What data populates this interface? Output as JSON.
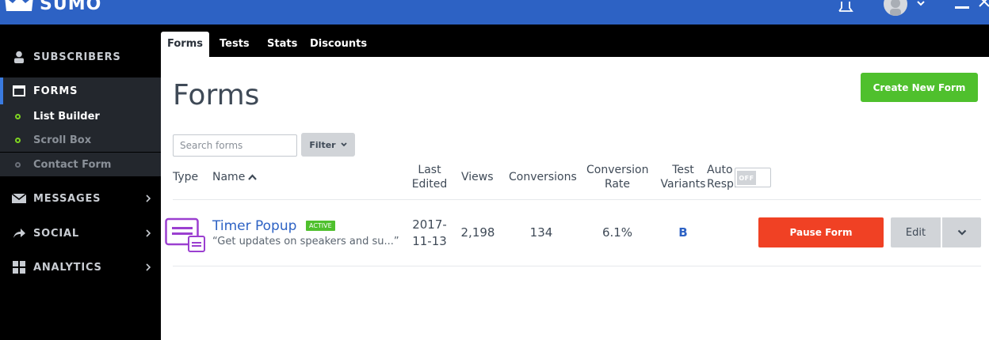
{
  "app": {
    "logo_text": "SUMO"
  },
  "sidebar": {
    "items": [
      {
        "label": "SUBSCRIBERS"
      },
      {
        "label": "FORMS"
      },
      {
        "label": "MESSAGES"
      },
      {
        "label": "SOCIAL"
      },
      {
        "label": "ANALYTICS"
      }
    ],
    "sub_items": [
      {
        "label": "List Builder"
      },
      {
        "label": "Scroll Box"
      },
      {
        "label": "Contact Form"
      }
    ]
  },
  "tabs": [
    {
      "label": "Forms"
    },
    {
      "label": "Tests"
    },
    {
      "label": "Stats"
    },
    {
      "label": "Discounts"
    }
  ],
  "main": {
    "title": "Forms",
    "create_button": "Create New Form",
    "search_placeholder": "Search forms",
    "filter_label": "Filter"
  },
  "table": {
    "headers": {
      "type": "Type",
      "name": "Name",
      "last_edited_1": "Last",
      "last_edited_2": "Edited",
      "views": "Views",
      "conversions": "Conversions",
      "conv_rate_1": "Conversion",
      "conv_rate_2": "Rate",
      "test_variants_1": "Test",
      "test_variants_2": "Variants",
      "auto_resp_1": "Auto",
      "auto_resp_2": "Resp.",
      "toggle": "OFF"
    },
    "rows": [
      {
        "name": "Timer Popup",
        "badge": "ACTIVE",
        "description": "“Get updates on speakers and su...”",
        "last_edited_1": "2017-",
        "last_edited_2": "11-13",
        "views": "2,198",
        "conversions": "134",
        "conversion_rate": "6.1%",
        "test_variants": "B",
        "pause_button": "Pause Form",
        "edit_button": "Edit"
      }
    ]
  },
  "colors": {
    "topbar": "#2d62c4",
    "sidebar": "#000000",
    "accent_green": "#4fc02d",
    "pause_red": "#f04124",
    "link_blue": "#2d62c4"
  }
}
